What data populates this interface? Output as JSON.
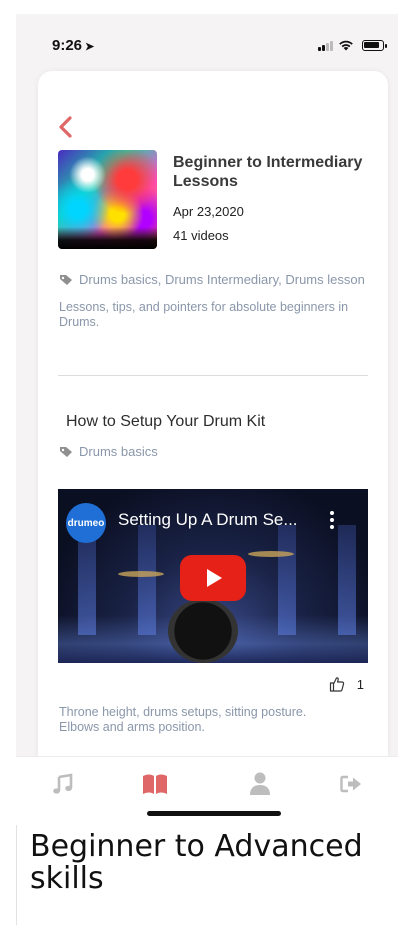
{
  "status_bar": {
    "time": "9:26",
    "location_arrow": "➤"
  },
  "playlist": {
    "title": "Beginner to Intermediary Lessons",
    "date": "Apr 23,2020",
    "count": "41 videos",
    "tags": "Drums basics, Drums Intermediary, Drums lesson",
    "description": "Lessons, tips, and pointers for absolute beginners in Drums."
  },
  "video": {
    "title": "How to Setup Your Drum Kit",
    "tags": "Drums basics",
    "channel_logo": "drumeo",
    "embed_caption": "Setting Up A Drum Se...",
    "likes": "1",
    "description": "Throne height, drums setups, sitting posture. Elbows and arms position."
  },
  "tabs": [
    {
      "icon": "music-note-icon",
      "active": false
    },
    {
      "icon": "book-icon",
      "active": true
    },
    {
      "icon": "user-icon",
      "active": false
    },
    {
      "icon": "logout-icon",
      "active": false
    }
  ],
  "caption": "Beginner to Advanced skills",
  "colors": {
    "accent": "#e06767",
    "muted_text": "#8a97aa",
    "inactive_icon": "#bdbdbd"
  }
}
